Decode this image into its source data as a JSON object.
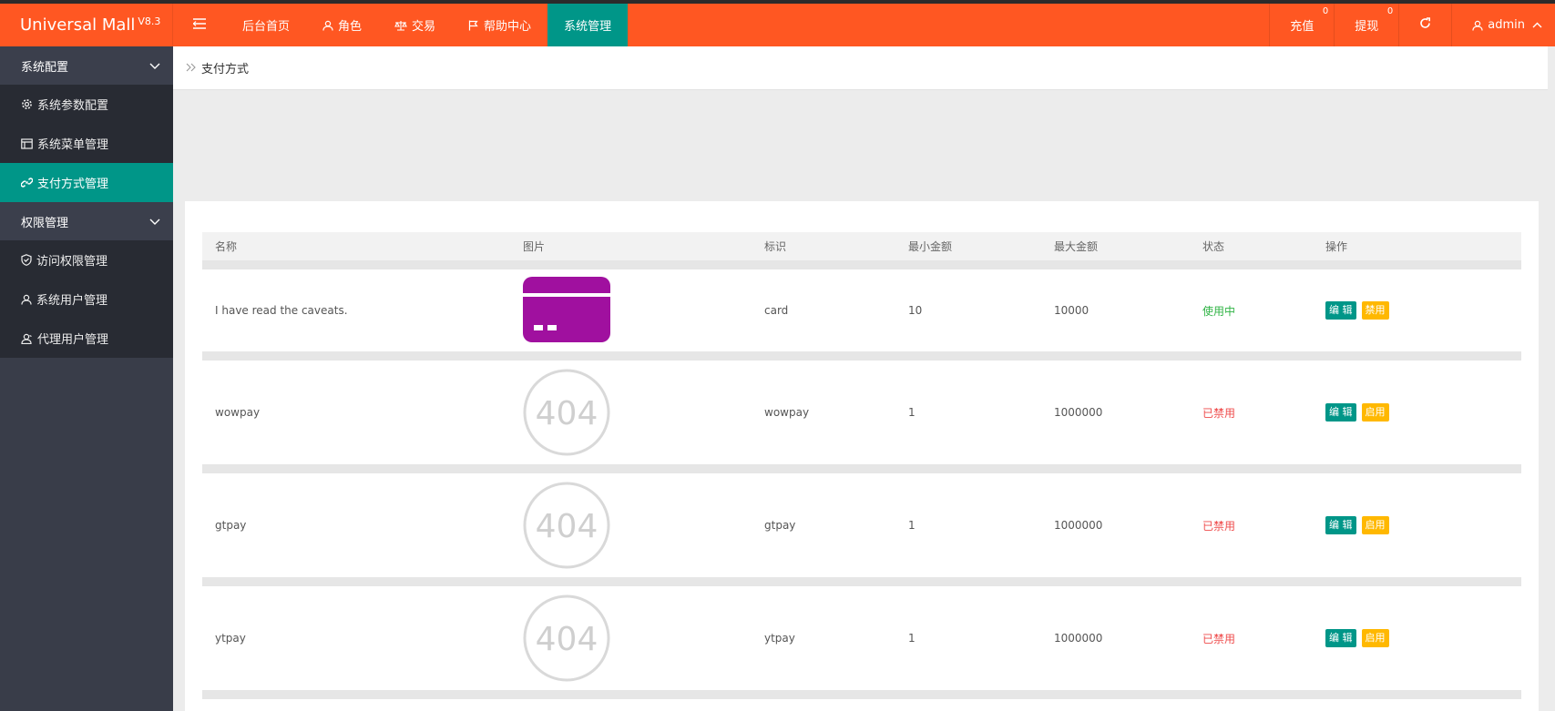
{
  "app": {
    "title": "Universal Mall",
    "version": "V8.3"
  },
  "header": {
    "nav": [
      {
        "label": "后台首页"
      },
      {
        "label": "角色"
      },
      {
        "label": "交易"
      },
      {
        "label": "帮助中心"
      },
      {
        "label": "系统管理"
      }
    ],
    "recharge": {
      "label": "充值",
      "count": "0"
    },
    "withdraw": {
      "label": "提现",
      "count": "0"
    },
    "user": "admin"
  },
  "sidebar": {
    "group1": "系统配置",
    "items1": [
      {
        "label": "系统参数配置"
      },
      {
        "label": "系统菜单管理"
      },
      {
        "label": "支付方式管理"
      }
    ],
    "group2": "权限管理",
    "items2": [
      {
        "label": "访问权限管理"
      },
      {
        "label": "系统用户管理"
      },
      {
        "label": "代理用户管理"
      }
    ]
  },
  "breadcrumb": "支付方式",
  "table": {
    "headers": [
      "名称",
      "图片",
      "标识",
      "最小金额",
      "最大金额",
      "状态",
      "操作"
    ],
    "rows": [
      {
        "name": "I have read the caveats.",
        "code": "card",
        "min": "10",
        "max": "10000",
        "status": "使用中",
        "edit": "编 辑",
        "action": "禁用"
      },
      {
        "name": "wowpay",
        "code": "wowpay",
        "min": "1",
        "max": "1000000",
        "status": "已禁用",
        "edit": "编 辑",
        "action": "启用"
      },
      {
        "name": "gtpay",
        "code": "gtpay",
        "min": "1",
        "max": "1000000",
        "status": "已禁用",
        "edit": "编 辑",
        "action": "启用"
      },
      {
        "name": "ytpay",
        "code": "ytpay",
        "min": "1",
        "max": "1000000",
        "status": "已禁用",
        "edit": "编 辑",
        "action": "启用"
      }
    ],
    "placeholder_image_text": "404"
  },
  "colors": {
    "header": "#ff5722",
    "accent": "#009688",
    "warn": "#ffb800",
    "card_icon": "#a0109f"
  },
  "icons": [
    "menu-toggle-icon",
    "user-icon",
    "scale-icon",
    "flag-icon",
    "refresh-icon",
    "chevron-up-icon",
    "chevron-down-icon",
    "gear-icon",
    "window-icon",
    "link-icon",
    "shield-icon",
    "person-icon",
    "agent-icon",
    "double-chevron-icon",
    "credit-card-icon"
  ]
}
